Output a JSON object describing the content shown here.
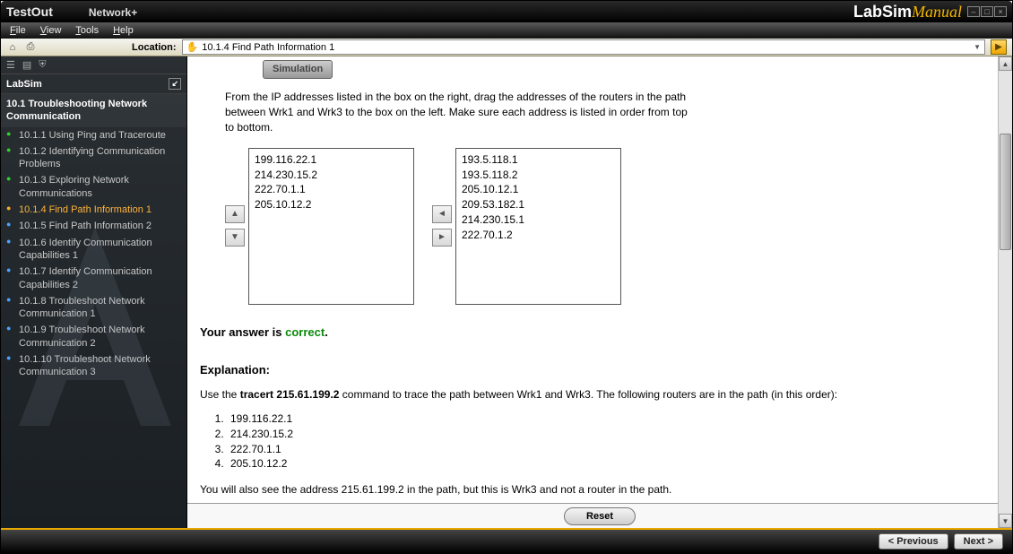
{
  "title": {
    "brand": "TestOut",
    "course": "Network+"
  },
  "labsim": {
    "text": "LabSim",
    "accent": "Manual"
  },
  "menu": {
    "file": "File",
    "view": "View",
    "tools": "Tools",
    "help": "Help"
  },
  "toolbar": {
    "location_label": "Location:",
    "location_value": "10.1.4 Find Path Information 1"
  },
  "sidebar": {
    "title": "LabSim",
    "section": "10.1 Troubleshooting Network Communication",
    "items": [
      {
        "label": "10.1.1 Using Ping and Traceroute",
        "kind": "green"
      },
      {
        "label": "10.1.2 Identifying Communication Problems",
        "kind": "green"
      },
      {
        "label": "10.1.3 Exploring Network Communications",
        "kind": "green"
      },
      {
        "label": "10.1.4 Find Path Information 1",
        "kind": "orange",
        "active": true
      },
      {
        "label": "10.1.5 Find Path Information 2",
        "kind": "blue"
      },
      {
        "label": "10.1.6 Identify Communication Capabilities 1",
        "kind": "blue"
      },
      {
        "label": "10.1.7 Identify Communication Capabilities 2",
        "kind": "blue"
      },
      {
        "label": "10.1.8 Troubleshoot Network Communication 1",
        "kind": "blue"
      },
      {
        "label": "10.1.9 Troubleshoot Network Communication 2",
        "kind": "blue"
      },
      {
        "label": "10.1.10 Troubleshoot Network Communication 3",
        "kind": "blue"
      }
    ]
  },
  "content": {
    "sim_button": "Simulation",
    "instructions": "From the IP addresses listed in the box on the right, drag the addresses of the routers in the path between Wrk1 and Wrk3 to the box on the left. Make sure each address is listed in order from top to bottom.",
    "left_box": [
      "199.116.22.1",
      "214.230.15.2",
      "222.70.1.1",
      "205.10.12.2"
    ],
    "right_box": [
      "193.5.118.1",
      "193.5.118.2",
      "205.10.12.1",
      "209.53.182.1",
      "214.230.15.1",
      "222.70.1.2"
    ],
    "answer_prefix": "Your answer is ",
    "answer_status": "correct",
    "answer_period": ".",
    "explanation_head": "Explanation:",
    "explanation_line1_a": "Use the ",
    "explanation_line1_cmd": "tracert 215.61.199.2",
    "explanation_line1_b": " command to trace the path between Wrk1 and Wrk3. The following routers are in the path (in this order):",
    "router_order": [
      "199.116.22.1",
      "214.230.15.2",
      "222.70.1.1",
      "205.10.12.2"
    ],
    "explanation_line2": "You will also see the address 215.61.199.2 in the path, but this is Wrk3 and not a router in the path.",
    "reset_label": "Reset"
  },
  "footer": {
    "prev": "< Previous",
    "next": "Next >"
  }
}
